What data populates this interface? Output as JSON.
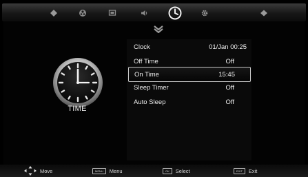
{
  "tabs": [
    {
      "icon": "picture-icon"
    },
    {
      "icon": "sound-icon"
    },
    {
      "icon": "channel-icon"
    },
    {
      "icon": "speaker-icon"
    },
    {
      "icon": "clock-icon"
    },
    {
      "icon": "gear-icon"
    },
    {
      "icon": "lock-icon"
    }
  ],
  "active_tab_icon": "clock-icon",
  "section": {
    "title": "TIME"
  },
  "menu": {
    "items": [
      {
        "label": "Clock",
        "value": "01/Jan  00:25"
      },
      {
        "label": "Off Time",
        "value": "Off"
      },
      {
        "label": "On Time",
        "value": "15:45"
      },
      {
        "label": "Sleep Timer",
        "value": "Off"
      },
      {
        "label": "Auto Sleep",
        "value": "Off"
      }
    ],
    "selected_label": "On Time"
  },
  "hints": [
    {
      "icon": "dpad-icon",
      "label": "Move"
    },
    {
      "key": "MENU",
      "label": "Menu"
    },
    {
      "key": "OK",
      "label": "Select"
    },
    {
      "key": "EXIT",
      "label": "Exit"
    }
  ],
  "colors": {
    "background": "#000000",
    "text": "#ececec",
    "selection_border": "#c8c8c8"
  }
}
